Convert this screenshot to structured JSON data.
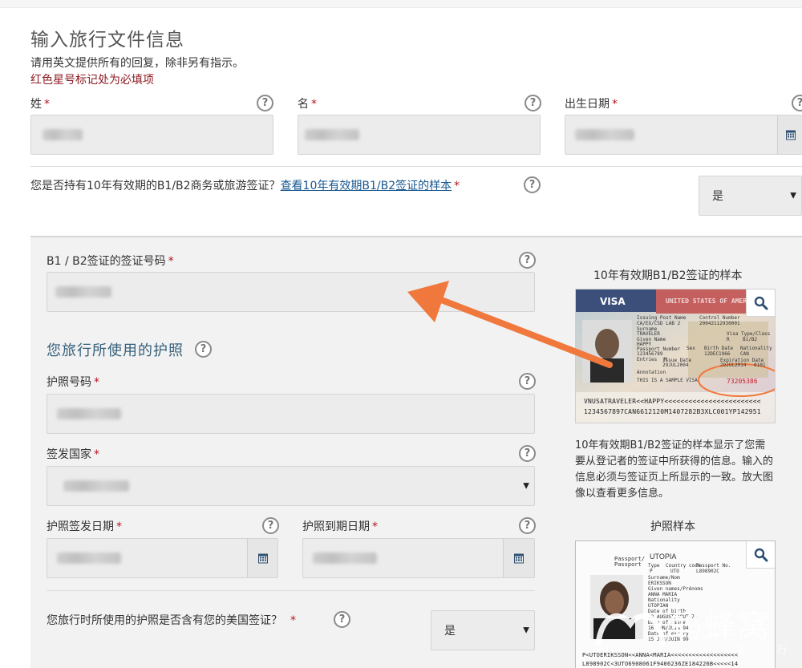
{
  "page": {
    "title": "输入旅行文件信息",
    "instructions": "请用英文提供所有的回复，除非另有指示。",
    "required_note": "红色星号标记处为必填项"
  },
  "name_row": {
    "surname_label": "姓",
    "given_label": "名",
    "dob_label": "出生日期"
  },
  "visa_question": {
    "text": "您是否持有10年有效期的B1/B2商务或旅游签证？",
    "link": "查看10年有效期B1/B2签证的样本",
    "selected": "是"
  },
  "visa_number": {
    "label": "B1 / B2签证的签证号码"
  },
  "passport_section": {
    "title": "您旅行所使用的护照",
    "number_label": "护照号码",
    "country_label": "签发国家",
    "issue_label": "护照签发日期",
    "expiry_label": "护照到期日期",
    "contains_visa_q": "您旅行时所使用的护照是否含有您的美国签证？",
    "contains_visa_selected": "是"
  },
  "visa_sample": {
    "title": "10年有效期B1/B2签证的样本",
    "description": "10年有效期B1/B2签证的样本显示了您需要从登记者的签证中所获得的信息。输入的信息必须与签证页上所显示的一致。放大图像以查看更多信息。",
    "image": {
      "visa_word": "VISA",
      "banner": "UNITED STATES OF AMERICA",
      "fields": [
        "Issuing Post Name",
        "CA/EX/CSD LAB 2",
        "Surname",
        "TRAVELER",
        "Given Name",
        "HAPPY",
        "Passport Number",
        "123456789",
        "Control Number",
        "20042112930001",
        "Visa Type/Class",
        "R",
        "B1/B2",
        "Entries",
        "M",
        "Sex",
        "Birth Date",
        "12DEC1966",
        "Nationality",
        "CAN",
        "Issue Date",
        "29JUL2004",
        "Expiration Date",
        "29JUL2014",
        "Annotation",
        "THIS IS A SAMPLE VISA",
        "0101"
      ],
      "serial": "73205386",
      "mrz1": "VNUSATRAVELER<<HAPPY<<<<<<<<<<<<<<<<<<<<<<<<",
      "mrz2": "1234567897CAN6612120M1407282B3XLC001YP142951"
    }
  },
  "passport_sample": {
    "title": "护照样本",
    "image": {
      "header_left": "Passport/",
      "header_left2": "Passport",
      "country": "UTOPIA",
      "fields": [
        "Type",
        "Country code",
        "Passport No.",
        "P",
        "UTO",
        "L898902C",
        "Surname/Nom",
        "ERIKSSON",
        "Given names/Prénoms",
        "ANNA MARIA",
        "Nationality",
        "UTOPIAN",
        "Date of birth",
        "12 AUGUST/AOUT 74",
        "Date of issue",
        "16 JUN/JUIN 94",
        "Date of expiry",
        "15 JUN/JUIN 99"
      ],
      "mrz1": "P<UTOERIKSSON<<ANNA<MARIA<<<<<<<<<<<<<<<<<<<",
      "mrz2": "L898902C<3UTO6908061F9406236ZE184226B<<<<<14"
    }
  },
  "help_glyph": "?",
  "required_star": "*",
  "watermark": {
    "main": "蚂蜂窝",
    "sub": "自 · 由 · 行"
  },
  "colors": {
    "required": "#b3151f",
    "link": "#17578f",
    "section_title": "#35607c",
    "arrow": "#f0783c",
    "field_bg": "#ececec",
    "panel_bg": "#f2f2f2"
  },
  "icons": {
    "help": "question-circle-icon",
    "calendar": "calendar-icon",
    "zoom": "magnifier-icon",
    "dropdown": "caret-down-icon"
  }
}
